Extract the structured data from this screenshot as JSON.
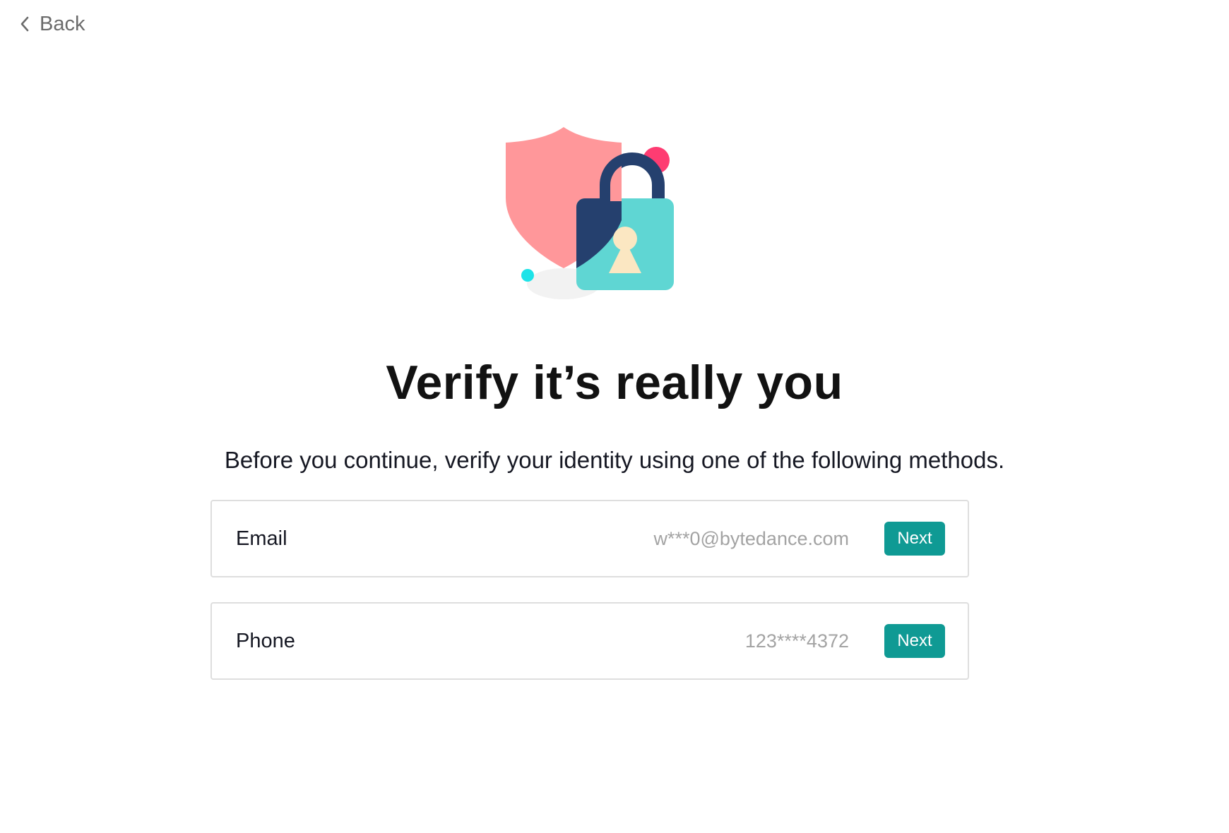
{
  "nav": {
    "back_label": "Back"
  },
  "heading": {
    "title": "Verify it’s really you",
    "subtitle": "Before you continue, verify your identity using one of the following methods."
  },
  "methods": [
    {
      "label": "Email",
      "value": "w***0@bytedance.com",
      "button_label": "Next"
    },
    {
      "label": "Phone",
      "value": "123****4372",
      "button_label": "Next"
    }
  ],
  "icons": {
    "back": "chevron-left-icon",
    "illustration": "shield-lock-illustration"
  },
  "colors": {
    "accent": "#0f9a94",
    "shield": "#ff979a",
    "lock_body": "#5fd6d3",
    "lock_dark": "#25406e",
    "keyhole": "#fbe7c2",
    "dot_pink": "#fe3c72",
    "dot_cyan": "#1de3e8"
  }
}
